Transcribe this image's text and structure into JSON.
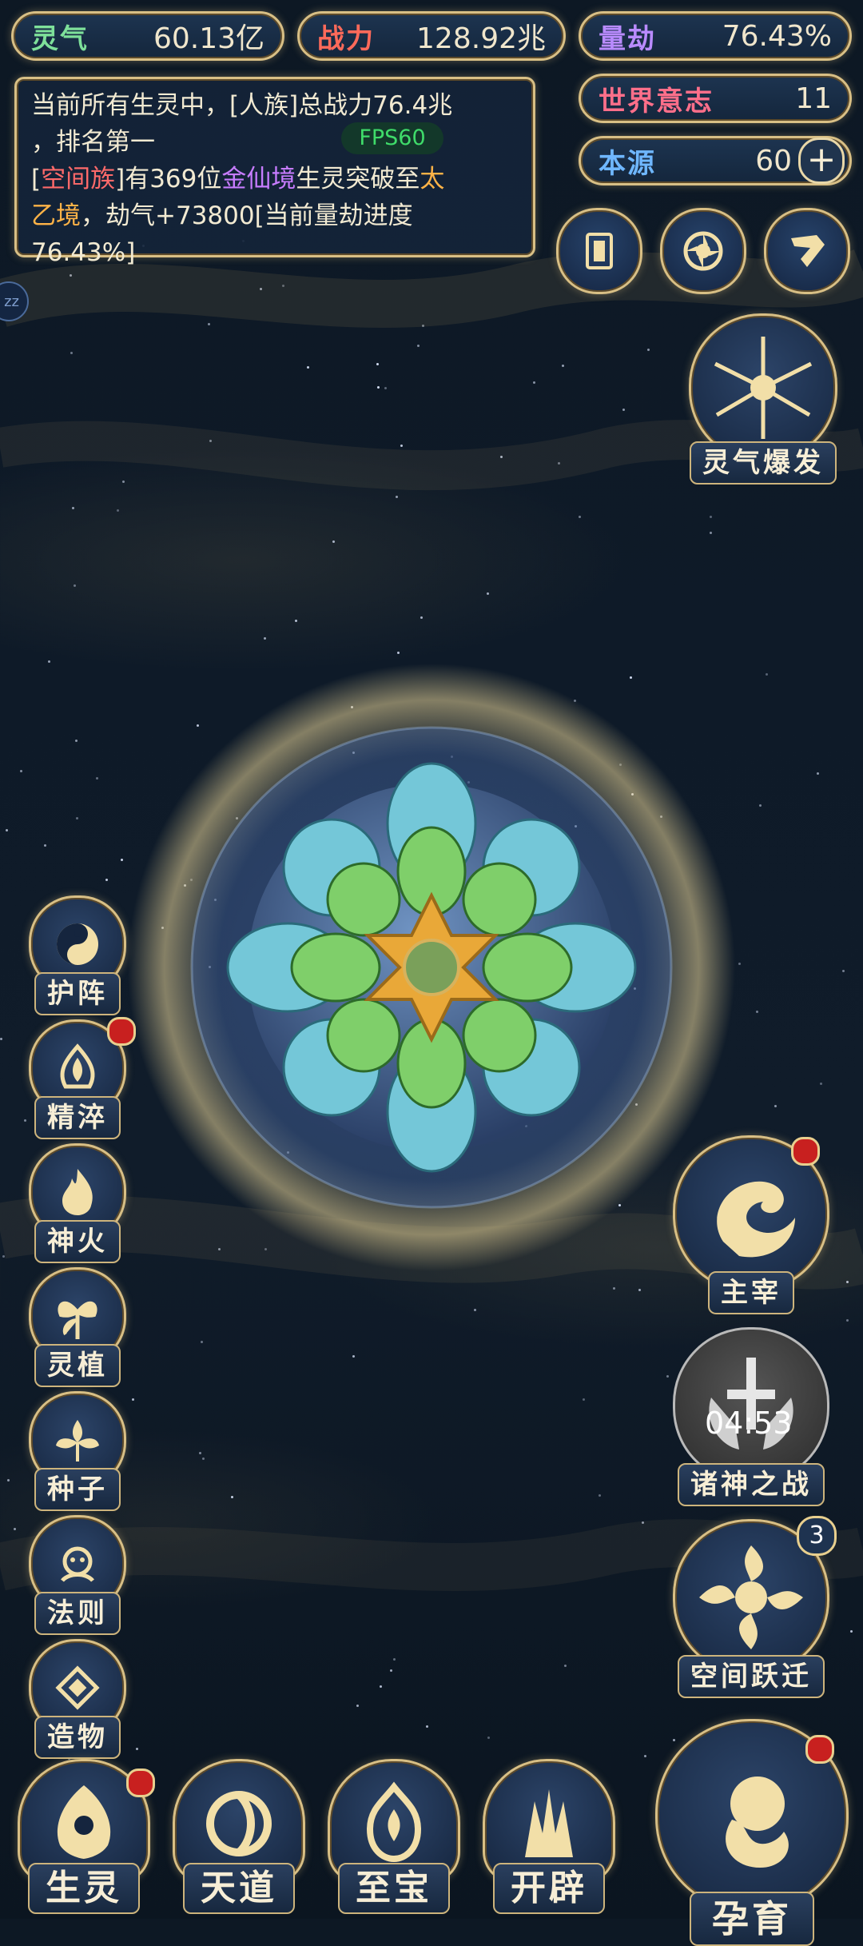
{
  "resources": {
    "lingqi": {
      "label": "灵气",
      "value": "60.13亿",
      "color": "#7ee09a"
    },
    "zhanli": {
      "label": "战力",
      "value": "128.92兆",
      "color": "#ff6a5a"
    },
    "liangjie": {
      "label": "量劫",
      "value": "76.43%",
      "color": "#b98bff"
    },
    "shijie": {
      "label": "世界意志",
      "value": "11",
      "color": "#ff6f8a"
    },
    "benyuan": {
      "label": "本源",
      "value": "60",
      "color": "#6fb7ff"
    }
  },
  "message": {
    "line1": "当前所有生灵中，[人族]总战力76.4兆",
    "line2": "，排名第一",
    "p_open": "[",
    "race": "空间族",
    "p_mid": "]有369位",
    "realm_from": "金仙境",
    "p_mid2": "生灵突破至",
    "realm_to_a": "太",
    "realm_to_b": "乙境",
    "p_end": "，劫气+73800[当前量劫进度",
    "progress": "76.43%]",
    "race_color": "#ff6a6a",
    "realm_from_color": "#c77cff",
    "realm_to_color": "#ffb347"
  },
  "fps": "FPS60",
  "side_bubble": "zz",
  "top_icons": [
    "card-icon",
    "swirl-icon",
    "scroll-icon"
  ],
  "right_buttons": {
    "burst": "灵气爆发",
    "ruler": "主宰",
    "war": "诸神之战",
    "timer": "04:53",
    "jump": "空间跃迁",
    "jump_badge": "3"
  },
  "left_skills": [
    "护阵",
    "精淬",
    "神火",
    "灵植",
    "种子",
    "法则",
    "造物"
  ],
  "bottom_nav": [
    "生灵",
    "天道",
    "至宝",
    "开辟"
  ],
  "nurture": "孕育",
  "colors": {
    "gold": "#d8bf85",
    "panel": "#14263c"
  }
}
